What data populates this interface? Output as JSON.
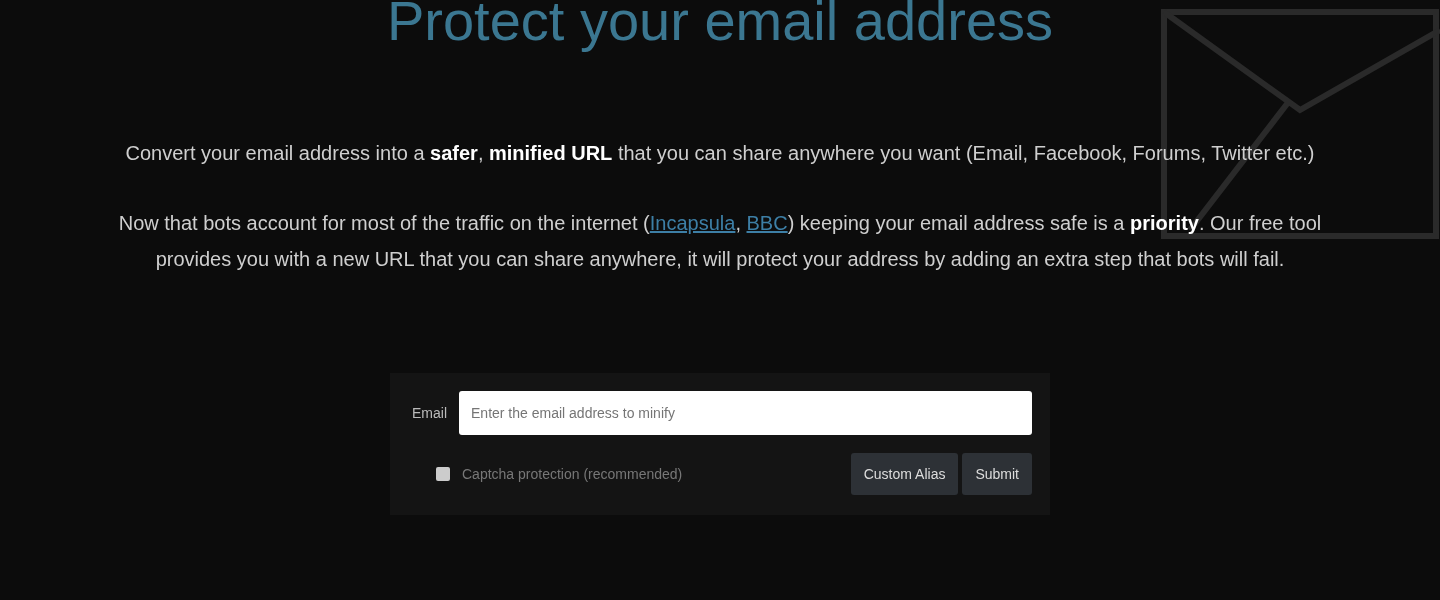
{
  "title": "Protect your email address",
  "intro": "Convert your email address into a **safer**, **minified URL** that you can share anywhere you want (Email, Facebook, Forums, Twitter etc.)",
  "explanation": [
    {
      "kind": "text",
      "text": "Now that bots account for most of the traffic on the internet ("
    },
    {
      "kind": "link",
      "text": "Incapsula"
    },
    {
      "kind": "text",
      "text": ", "
    },
    {
      "kind": "link",
      "text": "BBC"
    },
    {
      "kind": "text",
      "text": ") keeping your email address safe is a **priority**. Our free tool provides you with a new URL that you can share anywhere, it will protect your address by adding an extra step that bots will fail."
    }
  ],
  "form": {
    "email_label": "Email",
    "email_placeholder": "Enter the email address to minify",
    "captcha": {
      "label": "Captcha protection (recommended)",
      "checked": false
    },
    "buttons": [
      "Custom Alias",
      "Submit"
    ]
  }
}
